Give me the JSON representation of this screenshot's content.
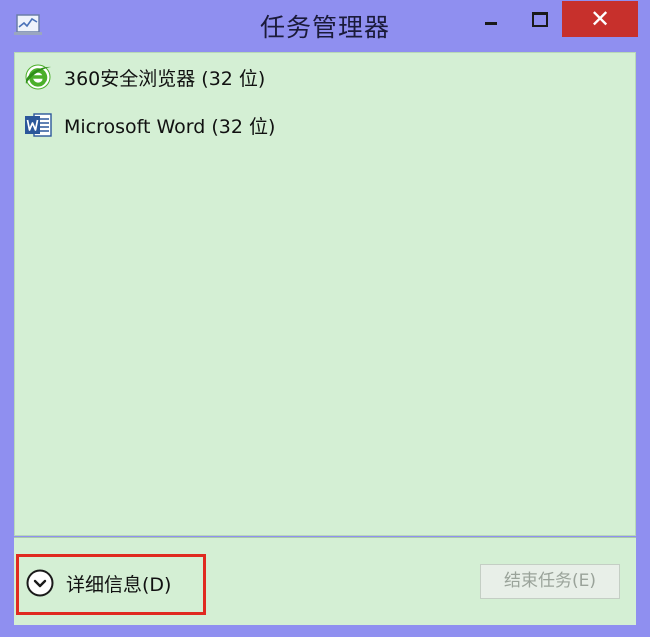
{
  "window": {
    "title": "任务管理器",
    "controls": {
      "close_glyph": "✕"
    }
  },
  "apps": [
    {
      "label": "360安全浏览器 (32 位)",
      "icon": "ie-browser-icon"
    },
    {
      "label": "Microsoft Word (32 位)",
      "icon": "word-icon"
    }
  ],
  "footer": {
    "details_label": "详细信息(D)",
    "end_task_label": "结束任务(E)",
    "end_task_enabled": false
  },
  "colors": {
    "window_frame": "#8f8ff0",
    "content_bg": "#d4efd4",
    "close_button": "#c7302c",
    "highlight_border": "#e02a20",
    "browser_green": "#4caf2a",
    "word_blue": "#2b579a"
  }
}
